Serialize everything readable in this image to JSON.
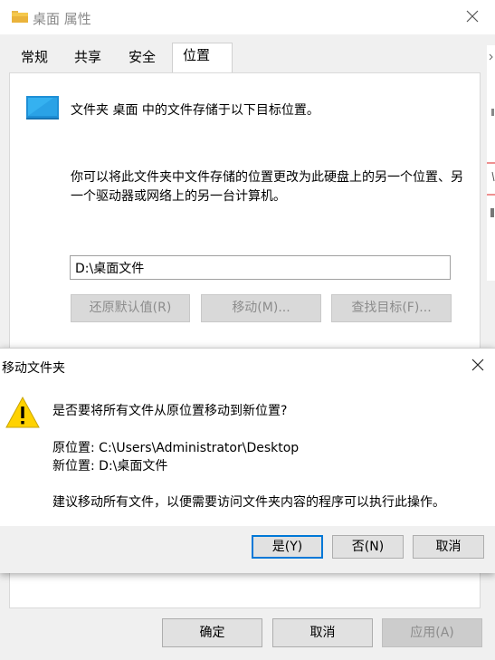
{
  "properties_window": {
    "title": "桌面 属性",
    "tabs": [
      "常规",
      "共享",
      "安全",
      "位置"
    ],
    "active_tab": "位置",
    "location_description": "文件夹 桌面 中的文件存储于以下目标位置。",
    "location_explanation": "你可以将此文件夹中文件存储的位置更改为此硬盘上的另一个位置、另一个驱动器或网络上的另一台计算机。",
    "path_value": "D:\\桌面文件",
    "buttons": {
      "restore_default": "还原默认值(R)",
      "move": "移动(M)...",
      "find_target": "查找目标(F)..."
    },
    "footer": {
      "ok": "确定",
      "cancel": "取消",
      "apply": "应用(A)"
    }
  },
  "move_dialog": {
    "title": "移动文件夹",
    "question": "是否要将所有文件从原位置移动到新位置?",
    "original_location": "原位置: C:\\Users\\Administrator\\Desktop",
    "new_location": "新位置: D:\\桌面文件",
    "advice": "建议移动所有文件，以便需要访问文件夹内容的程序可以执行此操作。",
    "buttons": {
      "yes": "是(Y)",
      "no": "否(N)",
      "cancel": "取消"
    }
  },
  "icons": {
    "folder": "folder-icon",
    "close": "close-icon",
    "monitor": "monitor-icon",
    "warning": "warning-icon"
  },
  "colors": {
    "accent": "#0078d7",
    "warning": "#ffd200",
    "monitor": "#29a8e8"
  }
}
